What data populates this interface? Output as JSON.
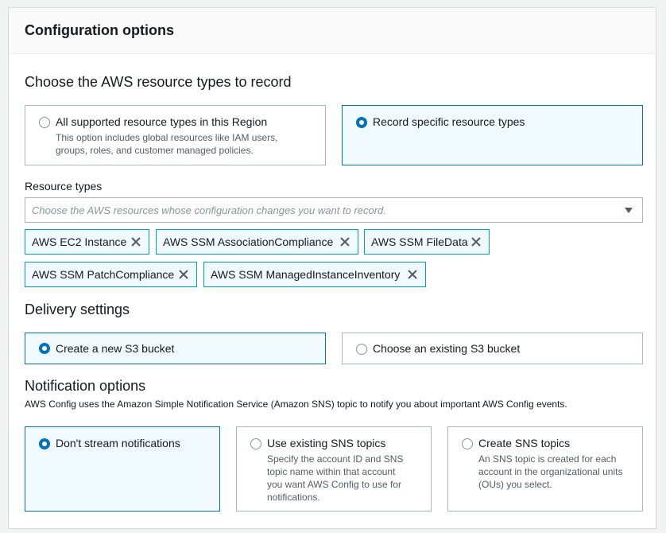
{
  "panel": {
    "title": "Configuration options"
  },
  "resource_section": {
    "heading": "Choose the AWS resource types to record",
    "options": [
      {
        "label": "All supported resource types in this Region",
        "description": [
          "This option includes global resources like IAM users,",
          "groups, roles, and customer managed policies."
        ],
        "selected": false
      },
      {
        "label": "Record specific resource types",
        "selected": true
      }
    ],
    "resource_types_label": "Resource types",
    "resource_types_placeholder": "Choose the AWS resources whose configuration changes you want to record.",
    "tokens": [
      "AWS EC2 Instance",
      "AWS SSM AssociationCompliance",
      "AWS SSM FileData",
      "AWS SSM PatchCompliance",
      "AWS SSM ManagedInstanceInventory"
    ]
  },
  "delivery_section": {
    "heading": "Delivery settings",
    "options": [
      {
        "label": "Create a new S3 bucket",
        "selected": true
      },
      {
        "label": "Choose an existing S3 bucket",
        "selected": false
      }
    ]
  },
  "notification_section": {
    "heading": "Notification options",
    "description": "AWS Config uses the Amazon Simple Notification Service (Amazon SNS) topic to notify you about important AWS Config events.",
    "options": [
      {
        "label": "Don't stream notifications",
        "selected": true
      },
      {
        "label": "Use existing SNS topics",
        "description": [
          "Specify the account ID and SNS",
          "topic name within that account",
          "you want AWS Config to use for",
          "notifications."
        ],
        "selected": false
      },
      {
        "label": "Create SNS topics",
        "description": [
          "An SNS topic is created for each",
          "account in the organizational units",
          "(OUs) you select."
        ],
        "selected": false
      }
    ]
  },
  "colors": {
    "accent": "#0073bb",
    "token_border": "#00a1c9",
    "selected_bg": "#f1faff",
    "border": "#aab7b8"
  },
  "icons": {
    "remove": "close-icon",
    "dropdown": "caret-down-icon"
  }
}
